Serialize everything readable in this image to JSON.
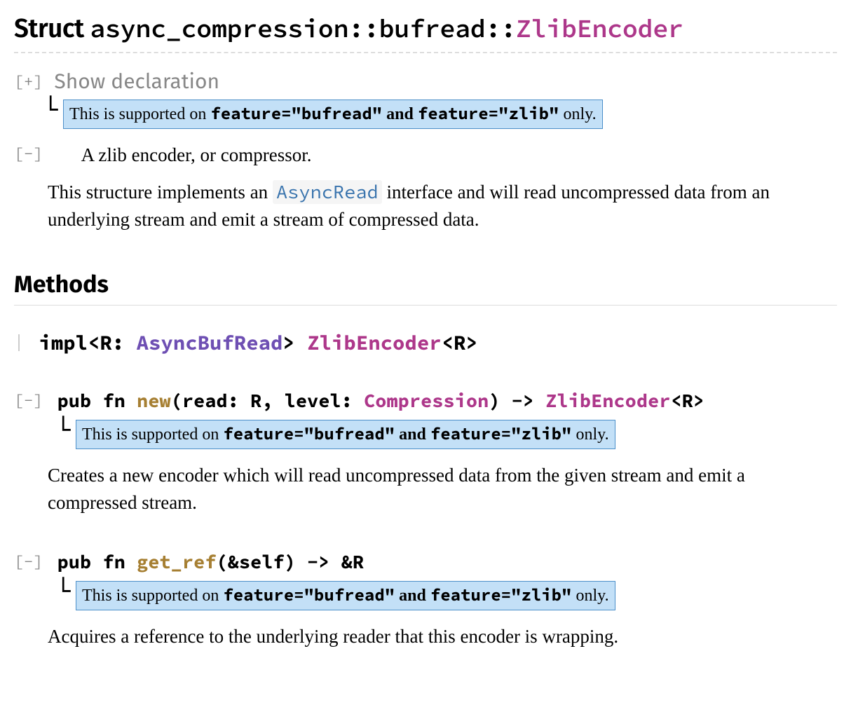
{
  "title": {
    "kind": "Struct",
    "crate": "async_compression",
    "module": "bufread",
    "type": "ZlibEncoder"
  },
  "declaration": {
    "toggle": "[+]",
    "label": "Show declaration"
  },
  "feature_gate": {
    "prefix": "This is supported on ",
    "feat1": "feature=\"bufread\"",
    "and": " and ",
    "feat2": "feature=\"zlib\"",
    "suffix": " only."
  },
  "summary": {
    "toggle": "[−]",
    "first_line": "A zlib encoder, or compressor.",
    "para_pre": "This structure implements an ",
    "link": "AsyncRead",
    "para_post": " interface and will read uncompressed data from an underlying stream and emit a stream of compressed data."
  },
  "methods_heading": "Methods",
  "impl": {
    "pre": "impl<R: ",
    "trait": "AsyncBufRead",
    "mid": "> ",
    "struct": "ZlibEncoder",
    "post": "<R>"
  },
  "methods": [
    {
      "toggle": "[−]",
      "sig": {
        "pre": "pub fn ",
        "name": "new",
        "args_pre": "(read: R, level: ",
        "arg_type": "Compression",
        "args_post": ") -> ",
        "ret_type": "ZlibEncoder",
        "ret_post": "<R>"
      },
      "doc": "Creates a new encoder which will read uncompressed data from the given stream and emit a compressed stream."
    },
    {
      "toggle": "[−]",
      "sig": {
        "pre": "pub fn ",
        "name": "get_ref",
        "args_pre": "(&self) -> &R",
        "arg_type": "",
        "args_post": "",
        "ret_type": "",
        "ret_post": ""
      },
      "doc": "Acquires a reference to the underlying reader that this encoder is wrapping."
    }
  ]
}
